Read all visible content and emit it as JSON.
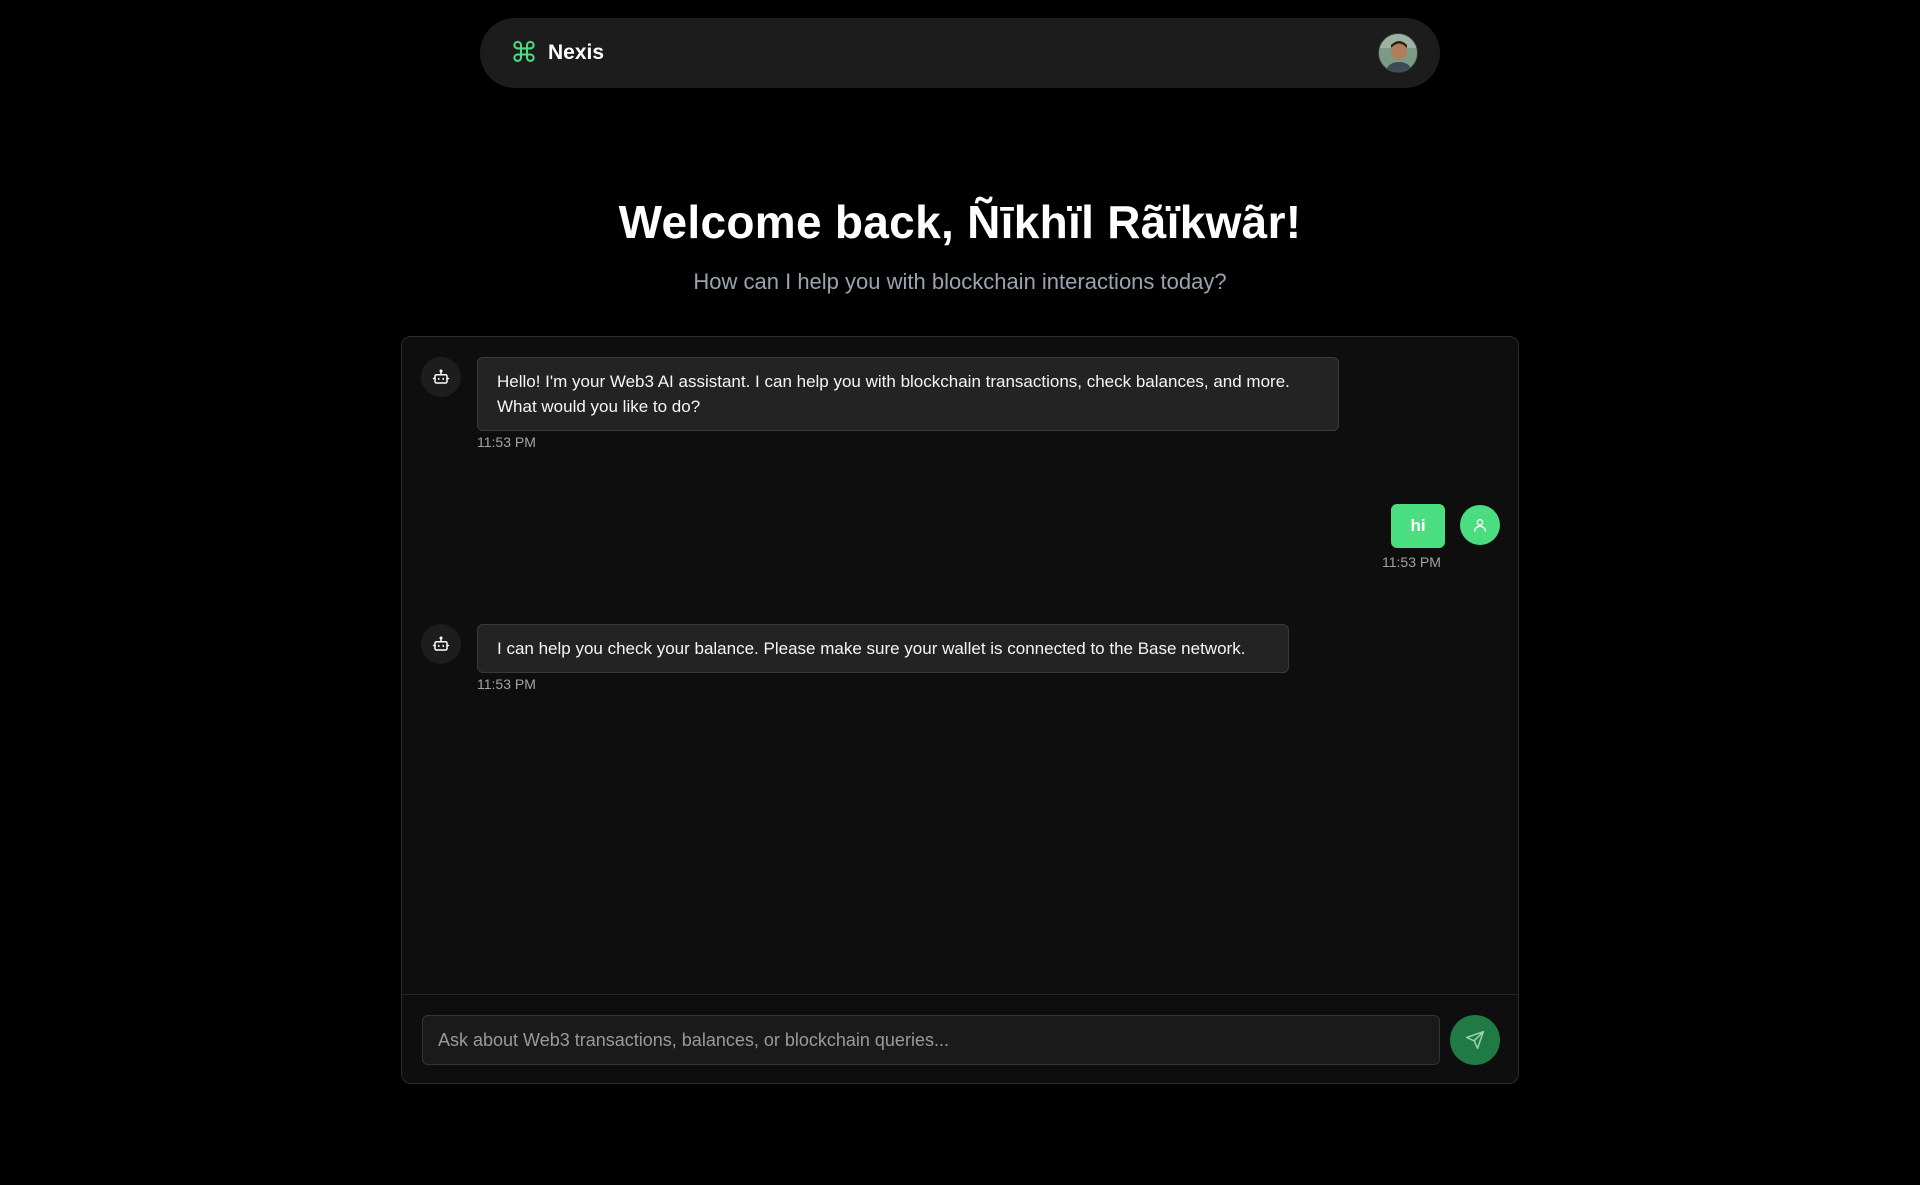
{
  "navbar": {
    "brand_icon": "command-icon",
    "brand_name": "Nexis",
    "accent_color": "#4ade80",
    "avatar_icon": "profile-photo"
  },
  "welcome": {
    "title": "Welcome back, Ñīkhïl Rãïkwãr!",
    "subtitle": "How can I help you with blockchain interactions today?"
  },
  "chat": {
    "messages": [
      {
        "role": "assistant",
        "icon": "bot-icon",
        "text": "Hello! I'm your Web3 AI assistant. I can help you with blockchain transactions, check balances, and more. What would you like to do?",
        "time": "11:53 PM"
      },
      {
        "role": "user",
        "icon": "user-icon",
        "text": "hi",
        "time": "11:53 PM"
      },
      {
        "role": "assistant",
        "icon": "bot-icon",
        "text": "I can help you check your balance. Please make sure your wallet is connected to the Base network.",
        "time": "11:53 PM"
      }
    ],
    "input": {
      "value": "",
      "placeholder": "Ask about Web3 transactions, balances, or blockchain queries..."
    },
    "send_icon": "send-icon"
  }
}
